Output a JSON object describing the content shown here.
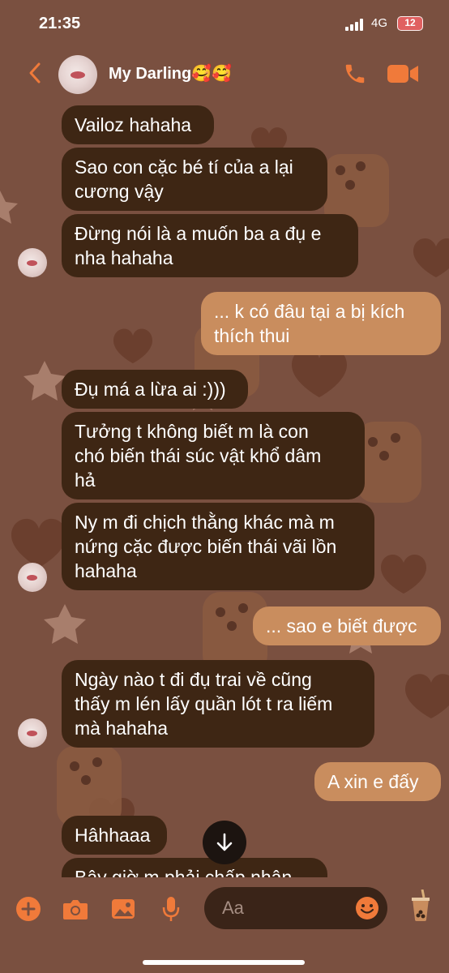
{
  "status_bar": {
    "time": "21:35",
    "network": "4G",
    "battery": "12",
    "battery_color": "#e06060"
  },
  "header": {
    "contact_name": "My Darling🥰🥰"
  },
  "colors": {
    "accent": "#f07a3a",
    "incoming_bubble": "#3e2614",
    "outgoing_bubble": "#c98d5e",
    "background": "#7a5040"
  },
  "messages": [
    {
      "side": "in",
      "text": "Vailoz hahaha"
    },
    {
      "side": "in",
      "text": "Sao con cặc bé tí của a lại\ncương vậy"
    },
    {
      "side": "in",
      "text": "Đừng nói là a muốn ba a đụ e\nnha hahaha"
    },
    {
      "side": "out",
      "text": "... k có đâu tại a bị kích\nthích thui"
    },
    {
      "side": "in",
      "text": "Đụ má a lừa ai :)))"
    },
    {
      "side": "in",
      "text": "Tưởng t không biết m là con\nchó biến thái súc vật khổ dâm\nhả"
    },
    {
      "side": "in",
      "text": "Ny m đi chịch thằng khác mà m\nnứng cặc được biến thái vãi lồn\nhahaha"
    },
    {
      "side": "out",
      "text": "... sao e biết được"
    },
    {
      "side": "in",
      "text": "Ngày nào t đi đụ trai về cũng\nthấy m lén lấy quần lót t ra liếm\nmà hahaha"
    },
    {
      "side": "out",
      "text": "A xin e đấy"
    },
    {
      "side": "in",
      "text": "Hâhhaaa"
    },
    {
      "side": "in",
      "text": "Bây giờ m phải chấp nhận"
    }
  ],
  "composer": {
    "placeholder": "Aa"
  },
  "icons": {
    "back": "chevron-left-icon",
    "call": "phone-icon",
    "video": "video-camera-icon",
    "plus": "plus-icon",
    "camera": "camera-icon",
    "gallery": "image-icon",
    "mic": "microphone-icon",
    "emoji": "smiley-icon",
    "quick_reaction": "bubble-tea-icon",
    "scroll": "arrow-down-icon"
  }
}
